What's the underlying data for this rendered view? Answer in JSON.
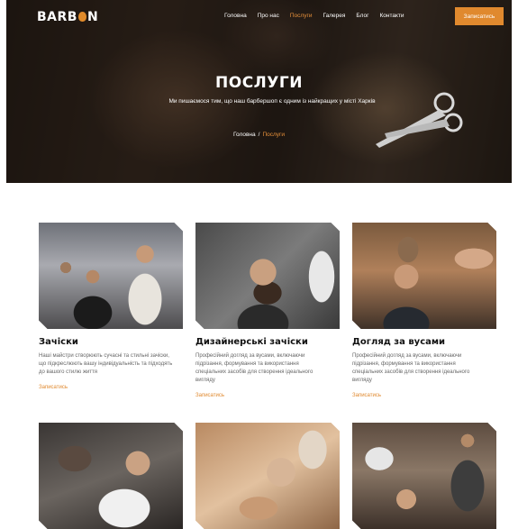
{
  "brand": {
    "logo_text_left": "BARB",
    "logo_text_right": "N"
  },
  "nav": {
    "items": [
      {
        "label": "Головна",
        "active": false
      },
      {
        "label": "Про нас",
        "active": false
      },
      {
        "label": "Послуги",
        "active": true
      },
      {
        "label": "Галерея",
        "active": false
      },
      {
        "label": "Блог",
        "active": false
      },
      {
        "label": "Контакти",
        "active": false
      }
    ],
    "cta_label": "Записатись"
  },
  "hero": {
    "title": "ПОСЛУГИ",
    "subtitle": "Ми пишаємося тим, що наш барбершоп є одним із найкращих у місті Харків",
    "breadcrumb": {
      "home": "Головна",
      "separator": "/",
      "current": "Послуги"
    }
  },
  "services": [
    {
      "title": "Зачіски",
      "description": "Наші майстри створюють сучасні та стильні зачіски, що підкреслюють вашу індивідуальність та підходять до вашого стилю життя",
      "link_label": "Записатись"
    },
    {
      "title": "Дизайнерські зачіски",
      "description": "Професійний догляд за вусами, включаючи підрізання, формування та використання спеціальних засобів для створення ідеального вигляду",
      "link_label": "Записатись"
    },
    {
      "title": "Догляд за вусами",
      "description": "Професійний догляд за вусами, включаючи підрізання, формування та використання спеціальних засобів для створення ідеального вигляду",
      "link_label": "Записатись"
    },
    {
      "title": "",
      "description": "",
      "link_label": ""
    },
    {
      "title": "",
      "description": "",
      "link_label": ""
    },
    {
      "title": "",
      "description": "",
      "link_label": ""
    }
  ],
  "colors": {
    "accent": "#e0892e",
    "text_dark": "#111111",
    "text_muted": "#666666"
  },
  "icons": {
    "logo_mark": "mustache-icon",
    "scissors": "scissors-icon"
  }
}
